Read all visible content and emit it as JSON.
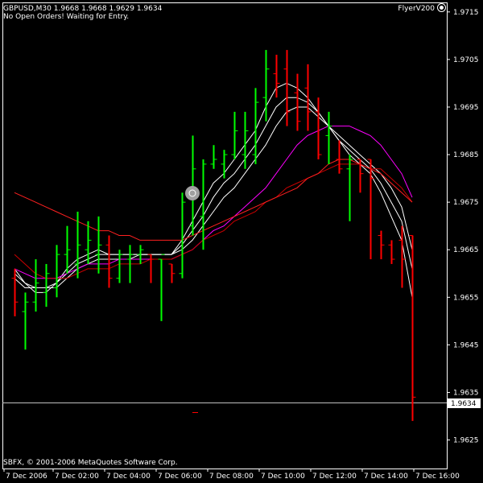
{
  "header": {
    "symbol": "GBPUSD,M30",
    "ohlc": "1.9668 1.9668 1.9629 1.9634",
    "status": "No Open Orders! Waiting for Entry.",
    "indicator": "FlyerV200",
    "copyright": "SBFX, © 2001-2006 MetaQuotes Software Corp."
  },
  "colors": {
    "background": "#000000",
    "axis": "#ffffff",
    "bull": "#00ff00",
    "bear": "#ff0000",
    "ma_fast": "#ffffff",
    "ma_slow": "#ff4040",
    "ma_magenta": "#ff00ff",
    "ma_darkred": "#cc0000"
  },
  "chart_data": {
    "type": "candlestick",
    "title": "",
    "xlabel": "",
    "ylabel": "",
    "ylim": [
      1.9619,
      1.9717
    ],
    "y_ticks": [
      "1.9715",
      "1.9705",
      "1.9695",
      "1.9685",
      "1.9675",
      "1.9665",
      "1.9655",
      "1.9645",
      "1.9635",
      "1.9625"
    ],
    "x_ticks": [
      "7 Dec 2006",
      "7 Dec 02:00",
      "7 Dec 04:00",
      "7 Dec 06:00",
      "7 Dec 08:00",
      "7 Dec 10:00",
      "7 Dec 12:00",
      "7 Dec 14:00",
      "7 Dec 16:00"
    ],
    "current_price": "1.9634",
    "bars": [
      {
        "o": 1.9659,
        "h": 1.9661,
        "l": 1.9651,
        "c": 1.9654
      },
      {
        "o": 1.9652,
        "h": 1.9656,
        "l": 1.9644,
        "c": 1.9654
      },
      {
        "o": 1.9654,
        "h": 1.9663,
        "l": 1.9652,
        "c": 1.9658
      },
      {
        "o": 1.9656,
        "h": 1.9662,
        "l": 1.9653,
        "c": 1.966
      },
      {
        "o": 1.9657,
        "h": 1.9666,
        "l": 1.9655,
        "c": 1.9664
      },
      {
        "o": 1.9664,
        "h": 1.967,
        "l": 1.966,
        "c": 1.9665
      },
      {
        "o": 1.9662,
        "h": 1.9673,
        "l": 1.9659,
        "c": 1.9666
      },
      {
        "o": 1.9665,
        "h": 1.9671,
        "l": 1.9662,
        "c": 1.9667
      },
      {
        "o": 1.9664,
        "h": 1.9672,
        "l": 1.966,
        "c": 1.9666
      },
      {
        "o": 1.9666,
        "h": 1.9668,
        "l": 1.9657,
        "c": 1.9659
      },
      {
        "o": 1.9659,
        "h": 1.9665,
        "l": 1.9658,
        "c": 1.9664
      },
      {
        "o": 1.9663,
        "h": 1.9666,
        "l": 1.9658,
        "c": 1.9664
      },
      {
        "o": 1.9664,
        "h": 1.9666,
        "l": 1.9662,
        "c": 1.9665
      },
      {
        "o": 1.9664,
        "h": 1.9664,
        "l": 1.9658,
        "c": 1.9663
      },
      {
        "o": 1.9663,
        "h": 1.9663,
        "l": 1.965,
        "c": 1.9664
      },
      {
        "o": 1.9662,
        "h": 1.9662,
        "l": 1.9658,
        "c": 1.966
      },
      {
        "o": 1.966,
        "h": 1.9677,
        "l": 1.9659,
        "c": 1.9675
      },
      {
        "o": 1.967,
        "h": 1.9689,
        "l": 1.9668,
        "c": 1.9682
      },
      {
        "o": 1.9672,
        "h": 1.9684,
        "l": 1.9665,
        "c": 1.9683
      },
      {
        "o": 1.9683,
        "h": 1.9687,
        "l": 1.9682,
        "c": 1.9684
      },
      {
        "o": 1.9683,
        "h": 1.9686,
        "l": 1.968,
        "c": 1.9685
      },
      {
        "o": 1.9685,
        "h": 1.9694,
        "l": 1.9684,
        "c": 1.969
      },
      {
        "o": 1.9685,
        "h": 1.9694,
        "l": 1.9682,
        "c": 1.969
      },
      {
        "o": 1.9685,
        "h": 1.9699,
        "l": 1.9683,
        "c": 1.9696
      },
      {
        "o": 1.9697,
        "h": 1.9707,
        "l": 1.9692,
        "c": 1.9703
      },
      {
        "o": 1.9702,
        "h": 1.9706,
        "l": 1.9697,
        "c": 1.97
      },
      {
        "o": 1.9703,
        "h": 1.9707,
        "l": 1.9691,
        "c": 1.9694
      },
      {
        "o": 1.9698,
        "h": 1.9702,
        "l": 1.969,
        "c": 1.9692
      },
      {
        "o": 1.9699,
        "h": 1.9704,
        "l": 1.969,
        "c": 1.9694
      },
      {
        "o": 1.9694,
        "h": 1.9697,
        "l": 1.9684,
        "c": 1.9685
      },
      {
        "o": 1.9689,
        "h": 1.9694,
        "l": 1.9683,
        "c": 1.9691
      },
      {
        "o": 1.9684,
        "h": 1.9688,
        "l": 1.9681,
        "c": 1.9682
      },
      {
        "o": 1.9682,
        "h": 1.9685,
        "l": 1.9671,
        "c": 1.9684
      },
      {
        "o": 1.9684,
        "h": 1.9684,
        "l": 1.9677,
        "c": 1.9681
      },
      {
        "o": 1.9684,
        "h": 1.9684,
        "l": 1.9663,
        "c": 1.968
      },
      {
        "o": 1.9668,
        "h": 1.9669,
        "l": 1.9663,
        "c": 1.9666
      },
      {
        "o": 1.9666,
        "h": 1.9667,
        "l": 1.9662,
        "c": 1.9663
      },
      {
        "o": 1.9667,
        "h": 1.967,
        "l": 1.9657,
        "c": 1.9663
      },
      {
        "o": 1.9668,
        "h": 1.9668,
        "l": 1.9629,
        "c": 1.9634
      }
    ],
    "series": [
      {
        "color": "#ffffff",
        "values": [
          1.9661,
          1.9658,
          1.9656,
          1.9656,
          1.9658,
          1.9661,
          1.9663,
          1.9664,
          1.9665,
          1.9664,
          1.9664,
          1.9664,
          1.9664,
          1.9664,
          1.9664,
          1.9664,
          1.9667,
          1.9671,
          1.9675,
          1.9679,
          1.9681,
          1.9684,
          1.9687,
          1.969,
          1.9695,
          1.9699,
          1.97,
          1.9699,
          1.9697,
          1.9694,
          1.9691,
          1.9688,
          1.9685,
          1.9683,
          1.9681,
          1.9677,
          1.9672,
          1.9667,
          1.9655
        ]
      },
      {
        "color": "#ffffff",
        "values": [
          1.966,
          1.9658,
          1.9657,
          1.9657,
          1.9658,
          1.966,
          1.9662,
          1.9663,
          1.9664,
          1.9664,
          1.9664,
          1.9664,
          1.9664,
          1.9664,
          1.9664,
          1.9664,
          1.9666,
          1.9669,
          1.9672,
          1.9676,
          1.9679,
          1.9681,
          1.9684,
          1.9687,
          1.9691,
          1.9695,
          1.9697,
          1.9697,
          1.9696,
          1.9694,
          1.9691,
          1.9688,
          1.9686,
          1.9684,
          1.9682,
          1.9679,
          1.9675,
          1.9671,
          1.9661
        ]
      },
      {
        "color": "#ffffff",
        "values": [
          1.9659,
          1.9657,
          1.9657,
          1.9657,
          1.9657,
          1.9659,
          1.9661,
          1.9662,
          1.9663,
          1.9663,
          1.9663,
          1.9663,
          1.9664,
          1.9664,
          1.9664,
          1.9664,
          1.9665,
          1.9667,
          1.967,
          1.9673,
          1.9676,
          1.9678,
          1.9681,
          1.9684,
          1.9687,
          1.9691,
          1.9694,
          1.9695,
          1.9695,
          1.9693,
          1.9691,
          1.9689,
          1.9687,
          1.9685,
          1.9683,
          1.9681,
          1.9678,
          1.9674,
          1.9665
        ]
      },
      {
        "color": "#ff00ff",
        "values": [
          1.9661,
          1.966,
          1.9659,
          1.9659,
          1.9659,
          1.966,
          1.9661,
          1.9662,
          1.9662,
          1.9662,
          1.9663,
          1.9663,
          1.9663,
          1.9663,
          1.9663,
          1.9663,
          1.9664,
          1.9665,
          1.9667,
          1.9669,
          1.967,
          1.9672,
          1.9674,
          1.9676,
          1.9678,
          1.9681,
          1.9684,
          1.9687,
          1.9689,
          1.969,
          1.9691,
          1.9691,
          1.9691,
          1.969,
          1.9689,
          1.9687,
          1.9684,
          1.9681,
          1.9676
        ]
      },
      {
        "color": "#cc0000",
        "values": [
          1.9664,
          1.9662,
          1.966,
          1.9659,
          1.9659,
          1.9659,
          1.966,
          1.9661,
          1.9661,
          1.9661,
          1.9662,
          1.9662,
          1.9662,
          1.9663,
          1.9663,
          1.9663,
          1.9664,
          1.9665,
          1.9667,
          1.9668,
          1.9669,
          1.9671,
          1.9672,
          1.9673,
          1.9675,
          1.9676,
          1.9678,
          1.9679,
          1.968,
          1.9681,
          1.9682,
          1.9683,
          1.9683,
          1.9683,
          1.9682,
          1.9682,
          1.968,
          1.9678,
          1.9675
        ]
      },
      {
        "color": "#ff2020",
        "values": [
          1.9677,
          1.9676,
          1.9675,
          1.9674,
          1.9673,
          1.9672,
          1.9671,
          1.967,
          1.9669,
          1.9669,
          1.9668,
          1.9668,
          1.9667,
          1.9667,
          1.9667,
          1.9667,
          1.9667,
          1.9668,
          1.9669,
          1.967,
          1.9671,
          1.9672,
          1.9673,
          1.9674,
          1.9675,
          1.9676,
          1.9677,
          1.9678,
          1.968,
          1.9681,
          1.9683,
          1.9684,
          1.9684,
          1.9683,
          1.9682,
          1.9681,
          1.9679,
          1.9677,
          1.9675
        ]
      }
    ]
  }
}
